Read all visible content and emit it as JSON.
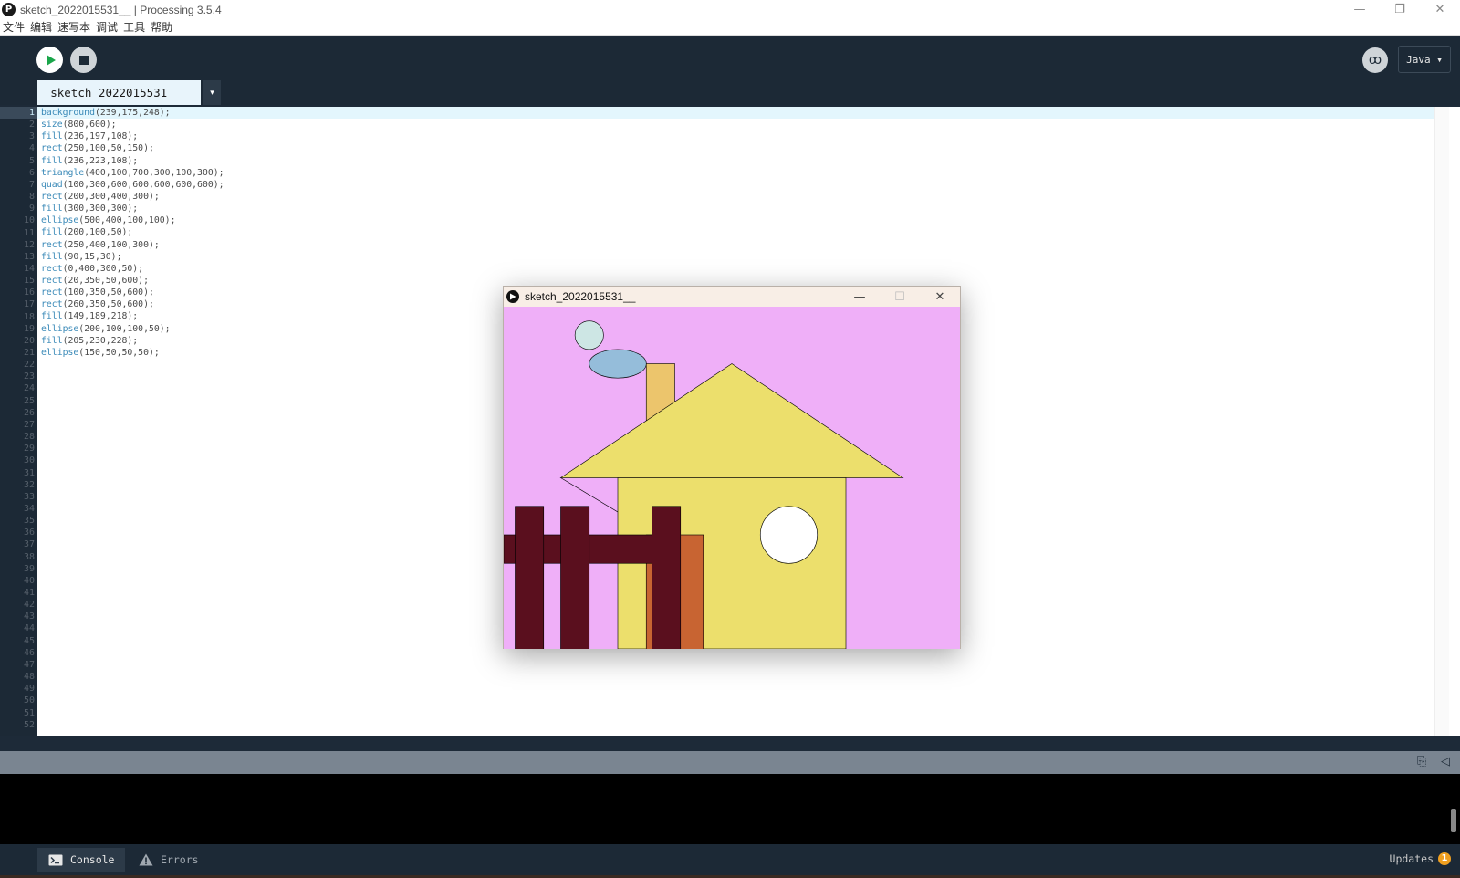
{
  "window": {
    "title": "sketch_2022015531__ | Processing 3.5.4",
    "app_icon_glyph": "P",
    "minimize": "—",
    "restore": "❐",
    "close": "✕"
  },
  "menu": [
    "文件",
    "编辑",
    "速写本",
    "调试",
    "工具",
    "帮助"
  ],
  "toolbar": {
    "run_icon": "play-icon",
    "stop_icon": "stop-icon",
    "debug_glyph": "ꝏ",
    "mode_label": "Java ▾"
  },
  "tabs": {
    "active_label": "sketch_2022015531___",
    "menu_glyph": "▾"
  },
  "editor": {
    "code_lines": [
      {
        "fn": "background",
        "args": "(239,175,248);"
      },
      {
        "fn": "size",
        "args": "(800,600);"
      },
      {
        "fn": "fill",
        "args": "(236,197,108);"
      },
      {
        "fn": "rect",
        "args": "(250,100,50,150);"
      },
      {
        "fn": "fill",
        "args": "(236,223,108);"
      },
      {
        "fn": "triangle",
        "args": "(400,100,700,300,100,300);"
      },
      {
        "fn": "quad",
        "args": "(100,300,600,600,600,600,600);"
      },
      {
        "fn": "rect",
        "args": "(200,300,400,300);"
      },
      {
        "fn": "fill",
        "args": "(300,300,300);"
      },
      {
        "fn": "ellipse",
        "args": "(500,400,100,100);"
      },
      {
        "fn": "fill",
        "args": "(200,100,50);"
      },
      {
        "fn": "rect",
        "args": "(250,400,100,300);"
      },
      {
        "fn": "fill",
        "args": "(90,15,30);"
      },
      {
        "fn": "rect",
        "args": "(0,400,300,50);"
      },
      {
        "fn": "rect",
        "args": "(20,350,50,600);"
      },
      {
        "fn": "rect",
        "args": "(100,350,50,600);"
      },
      {
        "fn": "rect",
        "args": "(260,350,50,600);"
      },
      {
        "fn": "fill",
        "args": "(149,189,218);"
      },
      {
        "fn": "ellipse",
        "args": "(200,100,100,50);"
      },
      {
        "fn": "fill",
        "args": "(205,230,228);"
      },
      {
        "fn": "ellipse",
        "args": "(150,50,50,50);"
      }
    ],
    "line_count": 52
  },
  "sketch_window": {
    "title": "sketch_2022015531__",
    "minimize": "—",
    "maximize": "☐",
    "close": "✕",
    "colors": {
      "background": "#efaff8",
      "chimney": "#ecc56c",
      "house": "#ecdf6c",
      "window": "#ffffff",
      "door": "#c8643",
      "fence": "#5a0f1e",
      "cloud": "#95bdda",
      "moon": "#cde6e4"
    }
  },
  "console": {
    "tabs": [
      {
        "label": "Console",
        "icon": "console-icon"
      },
      {
        "label": "Errors",
        "icon": "warning-icon"
      }
    ],
    "updates_label": "Updates",
    "updates_count": "1"
  }
}
